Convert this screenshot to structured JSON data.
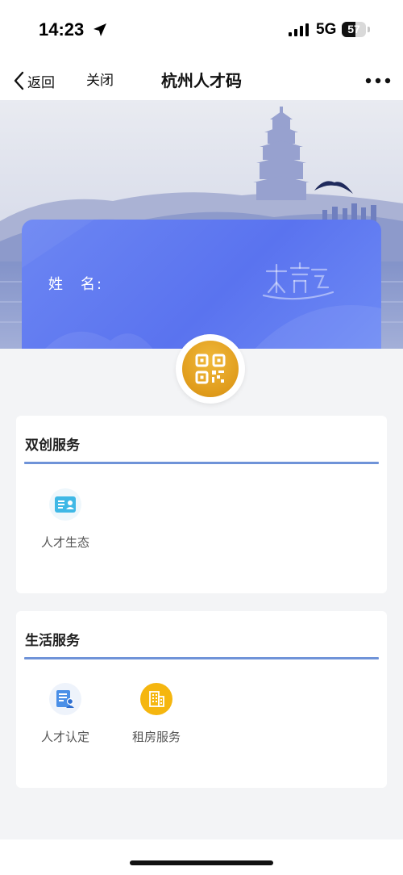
{
  "status_bar": {
    "time": "14:23",
    "network": "5G",
    "battery_level": "57",
    "battery_fraction": 0.57
  },
  "nav": {
    "back_label": "返回",
    "close_label": "关闭",
    "title": "杭州人才码",
    "more_icon": "more-dots-icon"
  },
  "card": {
    "name_label": "姓　名:",
    "name_value": "",
    "logo_icon": "hangzhou-logo-icon"
  },
  "qr_button": {
    "icon": "qr-code-icon",
    "color": "#e5a321"
  },
  "sections": [
    {
      "title": "双创服务",
      "items": [
        {
          "label": "人才生态",
          "icon": "id-card-icon",
          "color": "#39b5e6"
        }
      ]
    },
    {
      "title": "生活服务",
      "items": [
        {
          "label": "人才认定",
          "icon": "certificate-icon",
          "color": "#4a8fe7"
        },
        {
          "label": "租房服务",
          "icon": "building-icon",
          "color": "#f5b60f"
        }
      ]
    }
  ],
  "colors": {
    "accent_rule": "#6f93d8",
    "card_blue": "#5f78f0",
    "background": "#f3f4f6"
  }
}
